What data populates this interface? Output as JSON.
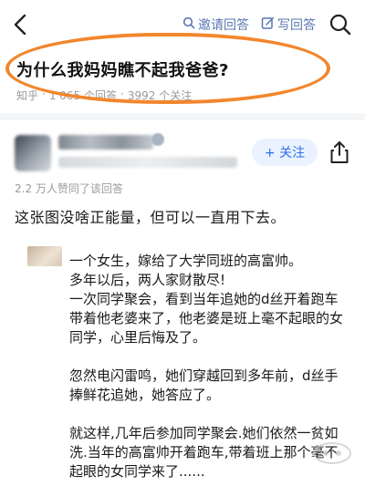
{
  "topbar": {
    "invite_label": "邀请回答",
    "write_label": "写回答",
    "icons": [
      "back-arrow-icon",
      "search-icon",
      "edit-icon",
      "share-icon"
    ]
  },
  "question": {
    "title": "为什么我妈妈瞧不起我爸爸?",
    "source": "知乎",
    "answers": "1 065 个回答",
    "separator": "·",
    "followers": "3992 个关注"
  },
  "author": {
    "follow_label": "+ 关注"
  },
  "answer": {
    "upvotes": "2.2 万人赞同了该回答",
    "intro": "这张图没啥正能量，但可以一直用下去。",
    "story_paragraphs": [
      "一个女生，嫁给了大学同班的高富帅。\n多年以后，两人家财散尽!\n一次同学聚会，看到当年追她的d丝开着跑车带着他老婆来了，他老婆是班上毫不起眼的女同学，心里后悔及了。",
      "忽然电闪雷鸣，她们穿越回到多年前，d丝手捧鲜花追她，她答应了。",
      "就这样,几年后参加同学聚会.她们依然一贫如洗.当年的高富帅开着跑车,带着班上那个毫不起眼的女同学来了......"
    ]
  },
  "colors": {
    "accent_blue": "#2b6fe6",
    "highlight_orange": "#f2862c",
    "meta_gray": "#9a9a9a"
  }
}
